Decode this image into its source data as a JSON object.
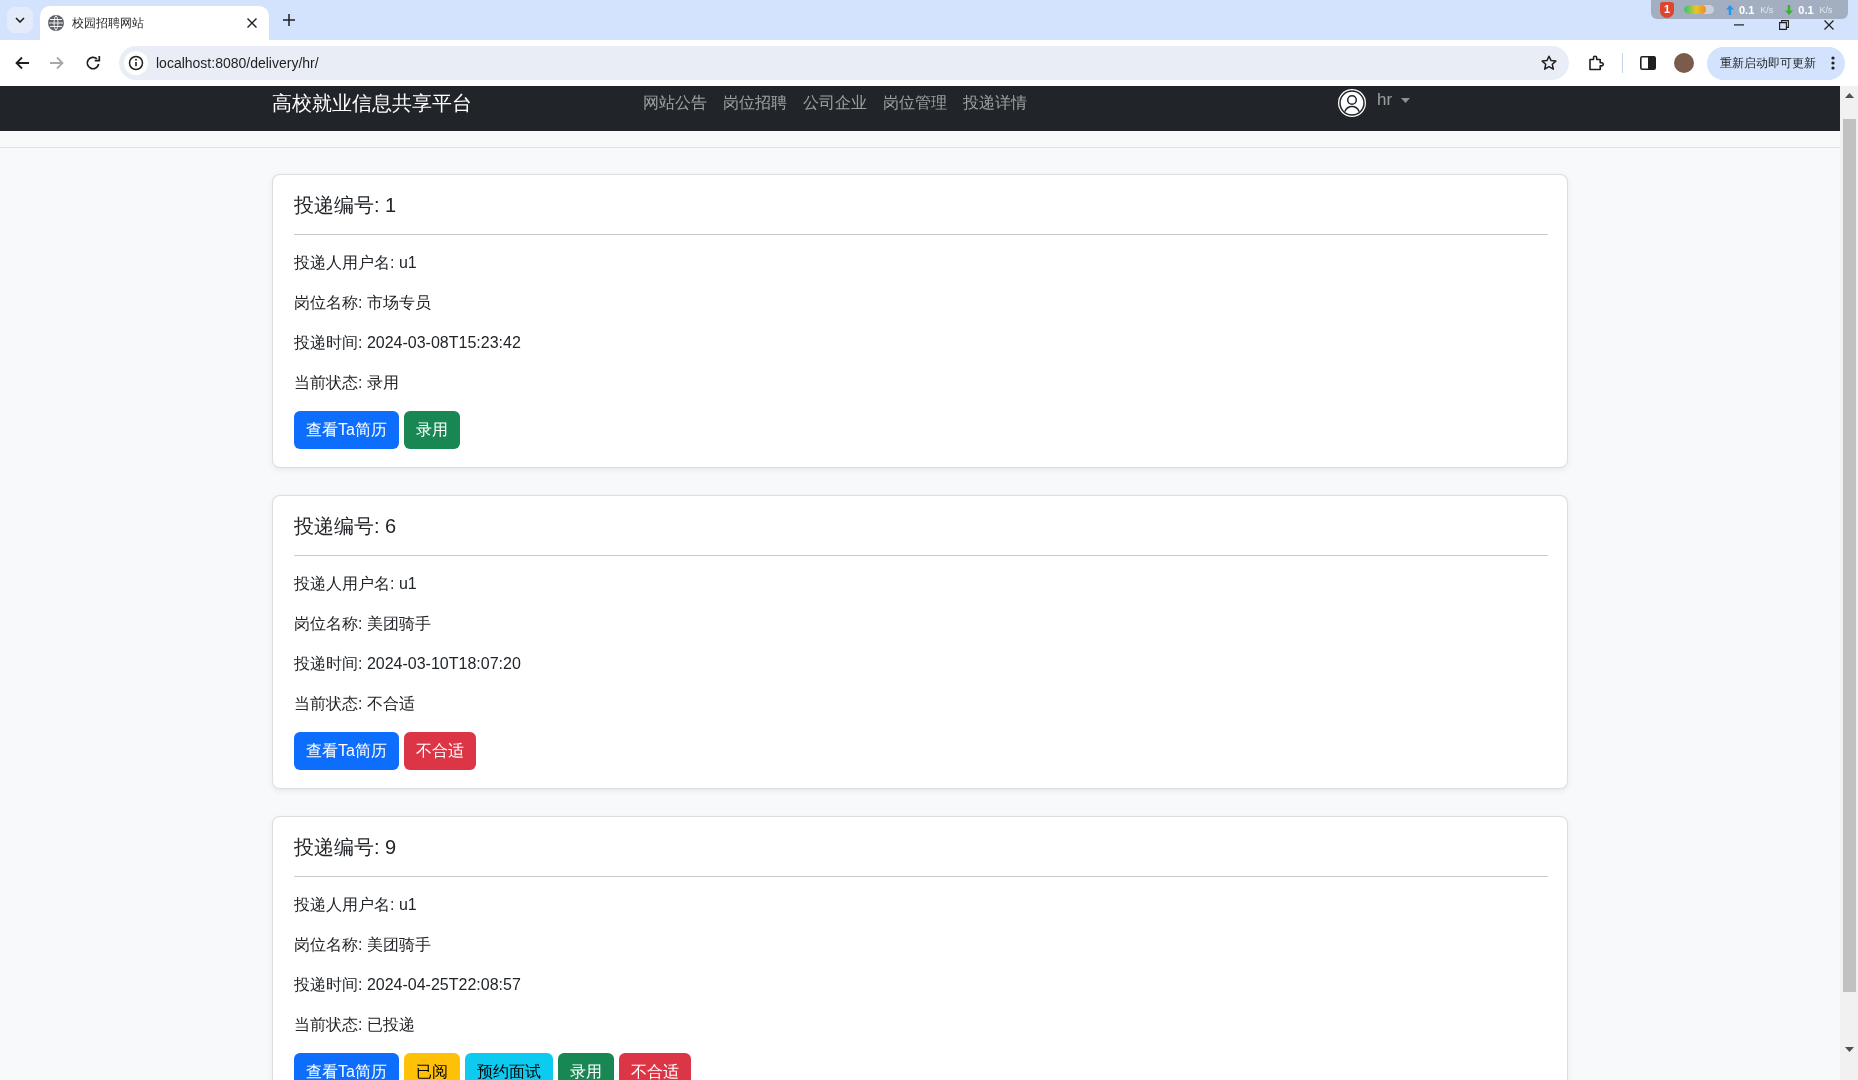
{
  "browser": {
    "tabs": [
      {
        "title": "校园招聘网站",
        "selected": true
      }
    ],
    "back_disabled": false,
    "forward_disabled": true,
    "address": "localhost:8080/delivery/hr/",
    "update_button": "重新启动即可更新"
  },
  "status_widget": {
    "badge": "1",
    "upload_rate": "0.1",
    "upload_unit": "K/s",
    "download_rate": "0.1",
    "download_unit": "K/s"
  },
  "navbar": {
    "brand": "高校就业信息共享平台",
    "links": [
      {
        "label": "网站公告",
        "selected": false
      },
      {
        "label": "岗位招聘",
        "selected": false
      },
      {
        "label": "公司企业",
        "selected": false
      },
      {
        "label": "岗位管理",
        "selected": false
      },
      {
        "label": "投递详情",
        "selected": false
      }
    ],
    "user": "hr"
  },
  "deliveries": [
    {
      "title": "投递编号: 1",
      "fields": [
        "投递人用户名: u1",
        "岗位名称: 市场专员",
        "投递时间: 2024-03-08T15:23:42",
        "当前状态: 录用"
      ],
      "buttons": [
        {
          "label": "查看Ta简历",
          "kind": "primary"
        },
        {
          "label": "录用",
          "kind": "success"
        }
      ]
    },
    {
      "title": "投递编号: 6",
      "fields": [
        "投递人用户名: u1",
        "岗位名称: 美团骑手",
        "投递时间: 2024-03-10T18:07:20",
        "当前状态: 不合适"
      ],
      "buttons": [
        {
          "label": "查看Ta简历",
          "kind": "primary"
        },
        {
          "label": "不合适",
          "kind": "danger"
        }
      ]
    },
    {
      "title": "投递编号: 9",
      "fields": [
        "投递人用户名: u1",
        "岗位名称: 美团骑手",
        "投递时间: 2024-04-25T22:08:57",
        "当前状态: 已投递"
      ],
      "buttons": [
        {
          "label": "查看Ta简历",
          "kind": "primary"
        },
        {
          "label": "已阅",
          "kind": "warning"
        },
        {
          "label": "预约面试",
          "kind": "info"
        },
        {
          "label": "录用",
          "kind": "success"
        },
        {
          "label": "不合适",
          "kind": "danger"
        }
      ]
    }
  ]
}
